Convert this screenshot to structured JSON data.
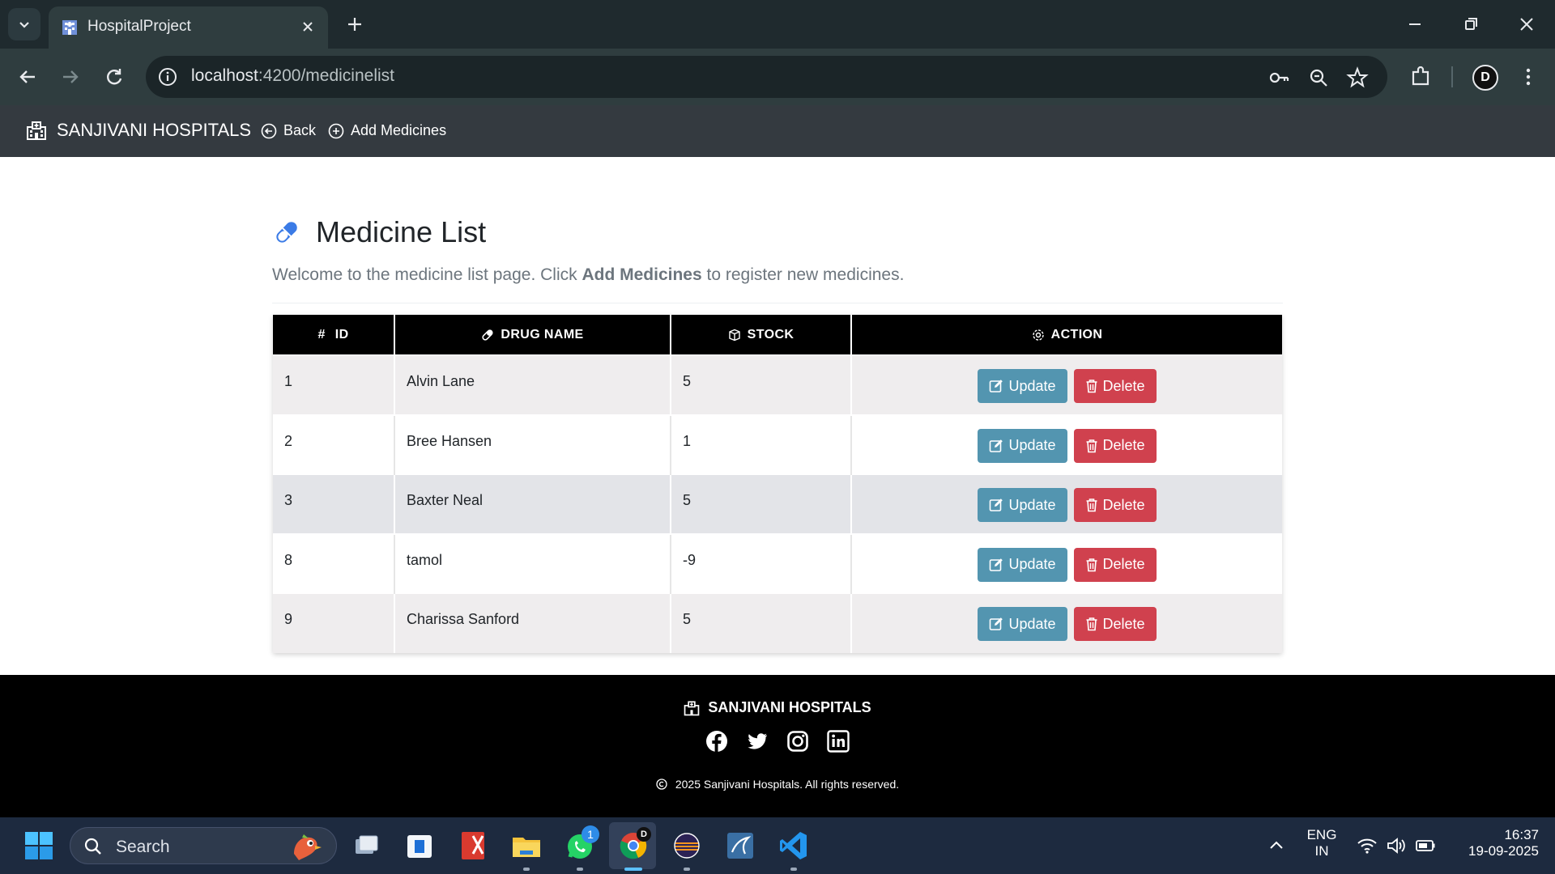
{
  "browser": {
    "tab_title": "HospitalProject",
    "url_host": "localhost",
    "url_path": ":4200/medicinelist"
  },
  "navbar": {
    "brand": "SANJIVANI HOSPITALS",
    "back_label": "Back",
    "add_label": "Add Medicines"
  },
  "page": {
    "title": "Medicine List",
    "lead_before": "Welcome to the medicine list page. Click ",
    "lead_bold": "Add Medicines",
    "lead_after": " to register new medicines."
  },
  "table": {
    "headers": {
      "id": "ID",
      "drug": "DRUG NAME",
      "stock": "STOCK",
      "action": "ACTION"
    },
    "rows": [
      {
        "id": "1",
        "name": "Alvin Lane",
        "stock": "5"
      },
      {
        "id": "2",
        "name": "Bree Hansen",
        "stock": "1"
      },
      {
        "id": "3",
        "name": "Baxter Neal",
        "stock": "5"
      },
      {
        "id": "8",
        "name": "tamol",
        "stock": "-9"
      },
      {
        "id": "9",
        "name": "Charissa Sanford",
        "stock": "5"
      }
    ],
    "update_label": "Update",
    "delete_label": "Delete"
  },
  "footer": {
    "brand": "SANJIVANI HOSPITALS",
    "copyright": "2025 Sanjivani Hospitals. All rights reserved."
  },
  "taskbar": {
    "search_label": "Search",
    "lang_1": "ENG",
    "lang_2": "IN",
    "time": "16:37",
    "date": "19-09-2025",
    "whatsapp_badge": "1"
  },
  "colors": {
    "navbar_bg": "#343a40",
    "update_btn": "#5395b0",
    "delete_btn": "#d0414e",
    "pill_icon": "#3b7be6"
  }
}
